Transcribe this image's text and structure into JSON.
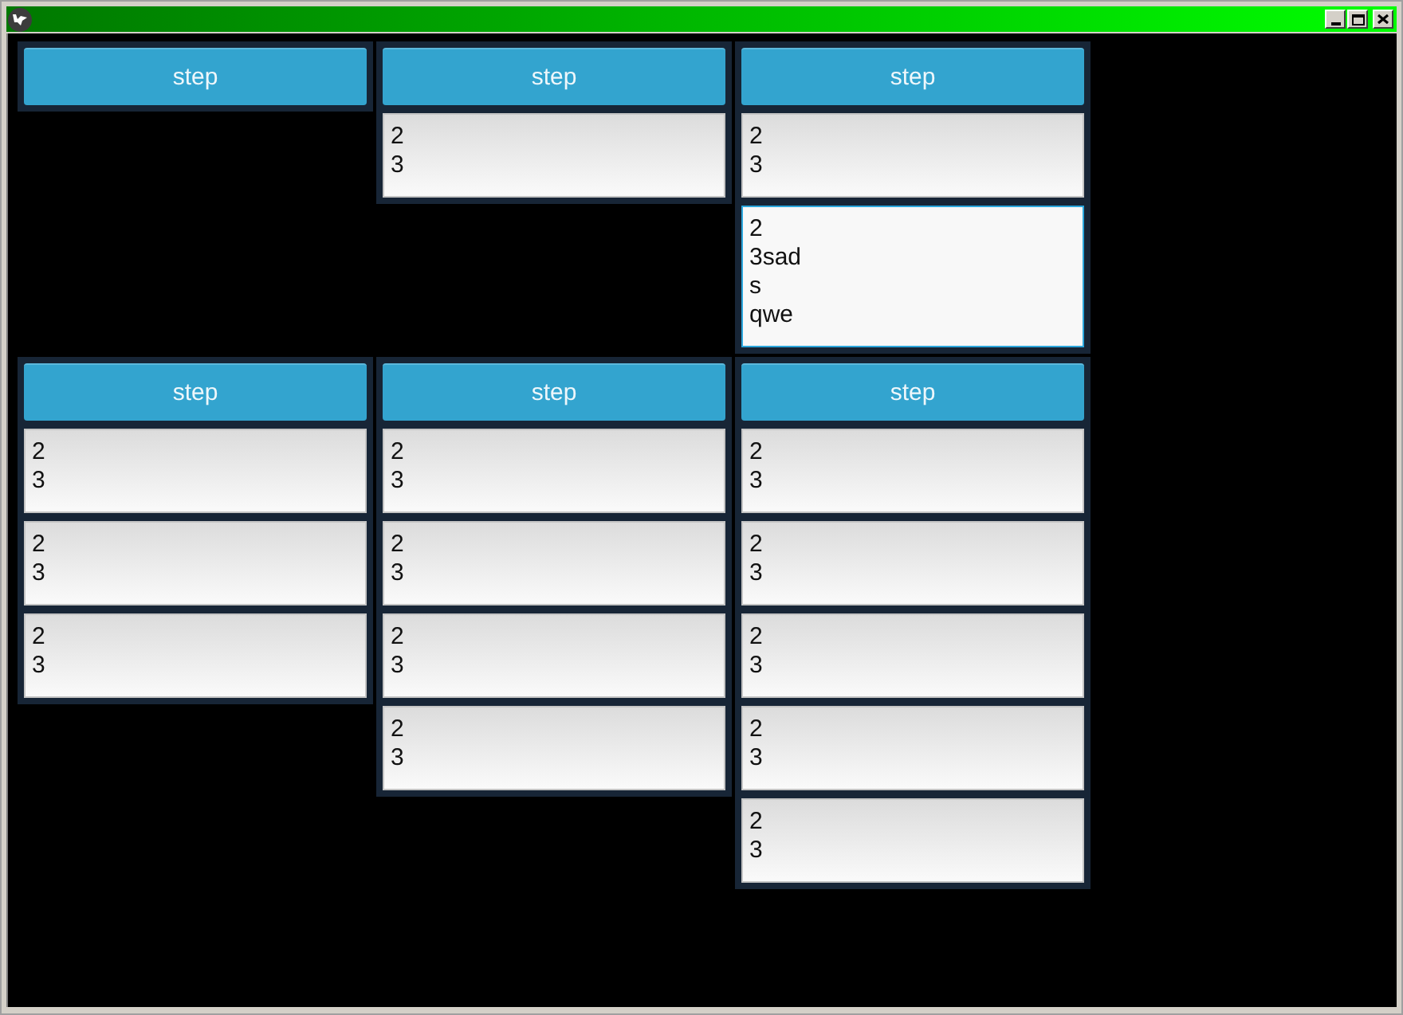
{
  "rows": [
    {
      "panels": [
        {
          "button": "step"
        },
        {
          "button": "step",
          "fields": [
            {
              "value": "2\n3",
              "focused": false
            }
          ]
        },
        {
          "button": "step",
          "fields": [
            {
              "value": "2\n3",
              "focused": false
            },
            {
              "value": "2\n3sad\ns\nqwe",
              "focused": true
            }
          ]
        }
      ]
    },
    {
      "panels": [
        {
          "button": "step",
          "fields": [
            {
              "value": "2\n3",
              "focused": false
            },
            {
              "value": "2\n3",
              "focused": false
            },
            {
              "value": "2\n3",
              "focused": false
            }
          ]
        },
        {
          "button": "step",
          "fields": [
            {
              "value": "2\n3",
              "focused": false
            },
            {
              "value": "2\n3",
              "focused": false
            },
            {
              "value": "2\n3",
              "focused": false
            },
            {
              "value": "2\n3",
              "focused": false
            }
          ]
        },
        {
          "button": "step",
          "fields": [
            {
              "value": "2\n3",
              "focused": false
            },
            {
              "value": "2\n3",
              "focused": false
            },
            {
              "value": "2\n3",
              "focused": false
            },
            {
              "value": "2\n3",
              "focused": false
            },
            {
              "value": "2\n3",
              "focused": false
            }
          ]
        }
      ]
    }
  ]
}
